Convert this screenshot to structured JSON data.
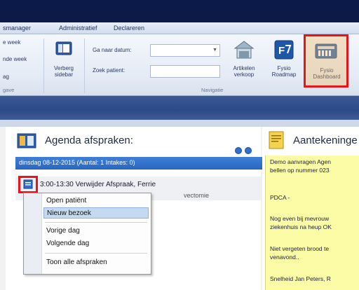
{
  "menu": {
    "items": [
      "smanager",
      "Administratief",
      "Declareren"
    ]
  },
  "ribbon": {
    "left_labels": [
      "e week",
      "nde week",
      "ag"
    ],
    "hide_sidebar_label": [
      "Verberg",
      "sidebar"
    ],
    "goto_date_label": "Ga naar datum:",
    "find_patient_label": "Zoek patient:",
    "goto_date_value": "",
    "find_patient_value": "",
    "sell_items_label": [
      "Artikelen",
      "verkoop"
    ],
    "roadmap_label": [
      "Fysio",
      "Roadmap"
    ],
    "dashboard_label": [
      "Fysio",
      "Dashboard"
    ],
    "group_left": "gave",
    "group_navigation": "Navigatie"
  },
  "agenda": {
    "title": "Agenda afspraken:",
    "day_header": "dinsdag 08-12-2015  (Aantal: 1  Intakes: 0)",
    "appointment": "3:00-13:30  Verwijder Afspraak, Ferrie",
    "appointment_sub": "vectomie"
  },
  "context_menu": {
    "items": [
      {
        "label": "Open patiënt",
        "selected": false
      },
      {
        "label": "Nieuw bezoek",
        "selected": true
      },
      {
        "label": "Vorige dag",
        "selected": false
      },
      {
        "label": "Volgende dag",
        "selected": false
      },
      {
        "label": "Toon alle afspraken",
        "selected": false
      }
    ]
  },
  "notes": {
    "title": "Aantekeninge",
    "lines": [
      "Demo aanvragen Agen",
      "bellen op nummer 023",
      "",
      "PDCA -",
      "",
      "Nog even bij mevrouw",
      "ziekenhuis na heup OK",
      "",
      "Niet vergeten brood te",
      "venavond..",
      "",
      "Snelheid Jan Peters, R"
    ]
  },
  "colors": {
    "highlight": "#e8141c",
    "header_blue": "#2a66c0",
    "notes_yellow": "#fcfba6"
  }
}
